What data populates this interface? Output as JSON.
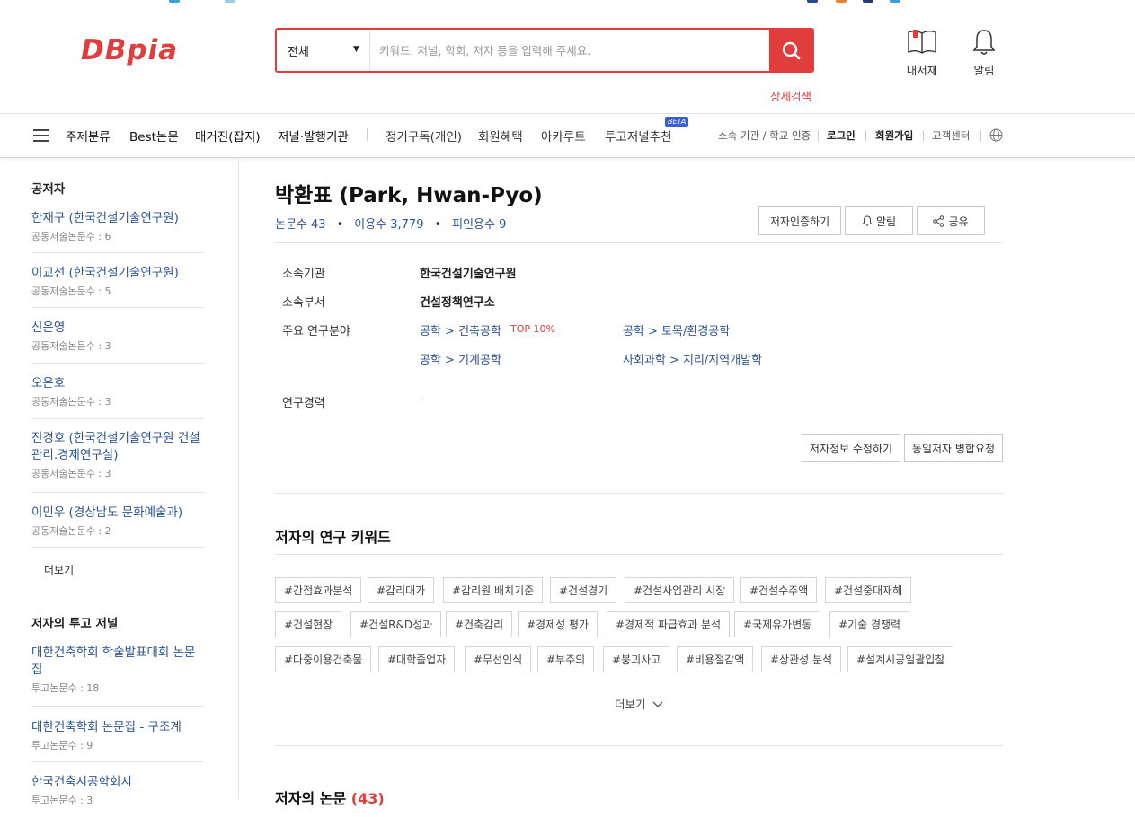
{
  "brand": {
    "logo_text": "DBpia",
    "accent": "#e23d3d",
    "link_color": "#2d5592"
  },
  "search": {
    "scope": "전체",
    "placeholder": "키워드, 저널, 학회, 저자 등을 입력해 주세요.",
    "advanced": "상세검색"
  },
  "header_icons": {
    "library": "내서재",
    "alerts": "알림"
  },
  "nav": {
    "items": [
      "주제분류",
      "Best논문",
      "매거진(잡지)",
      "저널·발행기관",
      "정기구독(개인)",
      "회원혜택",
      "아카루트",
      "투고저널추천"
    ],
    "beta": "BETA",
    "util": [
      "소속 기관 / 학교 인증",
      "로그인",
      "회원가입",
      "고객센터"
    ]
  },
  "sidebar": {
    "coauthors_title": "공저자",
    "coauthors": [
      {
        "name": "한재구 (한국건설기술연구원)",
        "sub": "공동저술논문수 : 6"
      },
      {
        "name": "이교선 (한국건설기술연구원)",
        "sub": "공동저술논문수 : 5"
      },
      {
        "name": "신은영",
        "sub": "공동저술논문수 : 3"
      },
      {
        "name": "오은호",
        "sub": "공동저술논문수 : 3"
      },
      {
        "name": "진경호 (한국건설기술연구원 건설관리.경제연구실)",
        "sub": "공동저술논문수 : 3"
      },
      {
        "name": "이민우 (경상남도 문화예술과)",
        "sub": "공동저술논문수 : 2"
      }
    ],
    "more": "더보기",
    "journals_title": "저자의 투고 저널",
    "journals": [
      {
        "name": "대한건축학회 학술발표대회 논문집",
        "sub": "투고논문수 : 18"
      },
      {
        "name": "대한건축학회 논문집 - 구조계",
        "sub": "투고논문수 : 9"
      },
      {
        "name": "한국건축시공학회지",
        "sub": "투고논문수 : 3"
      }
    ]
  },
  "author": {
    "name": "박환표 (Park, Hwan-Pyo)",
    "papers": "논문수 43",
    "uses": "이용수 3,779",
    "citations": "피인용수 9",
    "buttons": {
      "verify": "저자인증하기",
      "alert": "알림",
      "share": "공유"
    },
    "labels": {
      "org": "소속기관",
      "dept": "소속부서",
      "fields": "주요 연구분야",
      "career": "연구경력"
    },
    "org": "한국건설기술연구원",
    "dept": "건설정책연구소",
    "fields": [
      "공학 > 건축공학",
      "공학 > 토목/환경공학",
      "공학 > 기계공학",
      "사회과학 > 지리/지역개발학"
    ],
    "top_badge": "TOP 10%",
    "career": "-",
    "edit_buttons": {
      "edit": "저자정보 수정하기",
      "merge": "동일저자 병합요청"
    }
  },
  "keywords": {
    "title": "저자의 연구 키워드",
    "tags": [
      "#간접효과분석",
      "#감리대가",
      "#감리원 배치기준",
      "#건설경기",
      "#건설사업관리 시장",
      "#건설수주액",
      "#건설중대재해",
      "#건설현장",
      "#건설R&D성과",
      "#건축감리",
      "#경제성 평가",
      "#경제적 파급효과 분석",
      "#국제유가변동",
      "#기술 경쟁력",
      "#다중이용건축물",
      "#대학졸업자",
      "#무선인식",
      "#부주의",
      "#붕괴사고",
      "#비용절감액",
      "#상관성 분석",
      "#설계시공일괄입찰"
    ],
    "more": "더보기"
  },
  "papers_section": {
    "title": "저자의 논문",
    "count": "(43)"
  }
}
